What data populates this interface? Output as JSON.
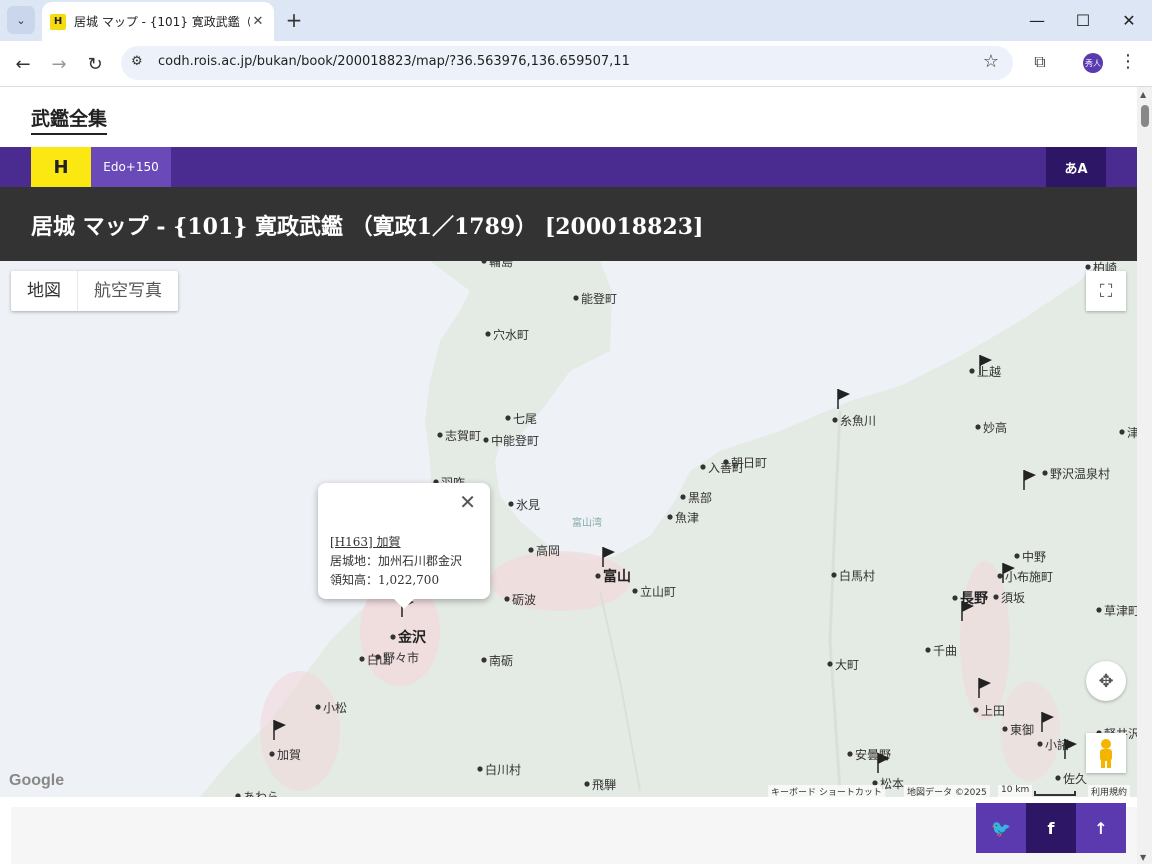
{
  "browser": {
    "tab_title": "居城 マップ - {101} 寛政武鑑（寛",
    "tab_favicon": "H",
    "url": "codh.rois.ac.jp/bukan/book/200018823/map/?36.563976,136.659507,11",
    "profile_label": "秀人"
  },
  "site": {
    "title": "武鑑全集",
    "logo_label": "H",
    "edo_label": "Edo+150",
    "lang_label": "あA"
  },
  "page": {
    "heading": "居城 マップ - {101} 寛政武鑑 （寛政1／1789） [200018823]"
  },
  "map": {
    "type_buttons": [
      "地図",
      "航空写真"
    ],
    "popup": {
      "link": "[H163] 加賀",
      "line1": "居城地：加州石川郡金沢",
      "line2": "領知高：1,022,700"
    },
    "google_label": "Google",
    "attribution": {
      "shortcuts": "キーボード ショートカット",
      "mapdata": "地図データ ©2025",
      "scale": "10 km",
      "terms": "利用規約"
    },
    "bay_label": "富山湾",
    "places": [
      {
        "name": "能登町"
      },
      {
        "name": "穴水町"
      },
      {
        "name": "七尾"
      },
      {
        "name": "志賀町"
      },
      {
        "name": "中能登町"
      },
      {
        "name": "氷見"
      },
      {
        "name": "高岡"
      },
      {
        "name": "富山"
      },
      {
        "name": "立山町"
      },
      {
        "name": "魚津"
      },
      {
        "name": "黒部"
      },
      {
        "name": "入善町"
      },
      {
        "name": "朝日町"
      },
      {
        "name": "糸魚川"
      },
      {
        "name": "上越"
      },
      {
        "name": "妙高"
      },
      {
        "name": "野沢温泉村"
      },
      {
        "name": "中野"
      },
      {
        "name": "小布施町"
      },
      {
        "name": "須坂"
      },
      {
        "name": "長野"
      },
      {
        "name": "白馬村"
      },
      {
        "name": "千曲"
      },
      {
        "name": "大町"
      },
      {
        "name": "上田"
      },
      {
        "name": "東御"
      },
      {
        "name": "小諸"
      },
      {
        "name": "安曇野"
      },
      {
        "name": "佐久"
      },
      {
        "name": "砺波"
      },
      {
        "name": "金沢"
      },
      {
        "name": "白山"
      },
      {
        "name": "野々市"
      },
      {
        "name": "南砺"
      },
      {
        "name": "小松"
      },
      {
        "name": "加賀"
      },
      {
        "name": "あわら"
      },
      {
        "name": "白川村"
      },
      {
        "name": "飛騨"
      },
      {
        "name": "草津町"
      },
      {
        "name": "柏崎"
      },
      {
        "name": "津"
      },
      {
        "name": "羽咋"
      },
      {
        "name": "輪島"
      },
      {
        "name": "軽井沢"
      },
      {
        "name": "松本"
      }
    ]
  },
  "share": {
    "twitter": "t",
    "facebook": "f",
    "top": "↑"
  }
}
